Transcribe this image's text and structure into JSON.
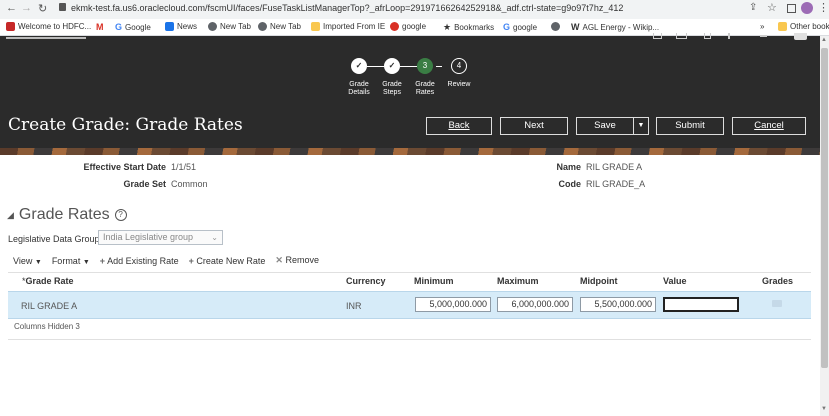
{
  "browser": {
    "url": "ekmk-test.fa.us6.oraclecloud.com/fscmUI/faces/FuseTaskListManagerTop?_afrLoop=29197166264252918&_adf.ctrl-state=g9o97t7hz_412",
    "bookmarks": [
      {
        "label": "Welcome to HDFC...",
        "color": "#c62828"
      },
      {
        "label": "Gmail",
        "color": "#d93025"
      },
      {
        "label": "Google",
        "color": "#4285f4"
      },
      {
        "label": "News",
        "color": "#1a73e8"
      },
      {
        "label": "New Tab",
        "color": "#5f6368"
      },
      {
        "label": "New Tab",
        "color": "#5f6368"
      },
      {
        "label": "Imported From IE",
        "color": "#f9c74f"
      },
      {
        "label": "google",
        "color": "#d93025"
      },
      {
        "label": "Bookmarks",
        "color": "#333333"
      },
      {
        "label": "google",
        "color": "#4285f4"
      },
      {
        "label": "AGL Energy - Wikip...",
        "color": "#333333"
      }
    ],
    "more_label": "»",
    "other_bookmarks": "Other bookmarks"
  },
  "train": {
    "steps": [
      {
        "num": "✓",
        "label1": "Grade",
        "label2": "Details"
      },
      {
        "num": "✓",
        "label1": "Grade",
        "label2": "Steps"
      },
      {
        "num": "3",
        "label1": "Grade",
        "label2": "Rates"
      },
      {
        "num": "4",
        "label1": "Review",
        "label2": ""
      }
    ]
  },
  "page": {
    "title": "Create Grade: Grade Rates",
    "buttons": {
      "back": "Back",
      "next": "Next",
      "save": "Save",
      "submit": "Submit",
      "cancel": "Cancel"
    }
  },
  "summary": {
    "effective_start_date_label": "Effective Start Date",
    "effective_start_date": "1/1/51",
    "grade_set_label": "Grade Set",
    "grade_set": "Common",
    "name_label": "Name",
    "name": "RIL GRADE A",
    "code_label": "Code",
    "code": "RIL GRADE_A"
  },
  "section": {
    "title": "Grade Rates",
    "ldg_label": "Legislative Data Group",
    "ldg_value": "India Legislative group"
  },
  "toolbar": {
    "view": "View",
    "format": "Format",
    "add_existing": "Add Existing Rate",
    "create_new": "Create New Rate",
    "remove": "Remove"
  },
  "table": {
    "headers": {
      "grade_rate": "Grade Rate",
      "currency": "Currency",
      "minimum": "Minimum",
      "maximum": "Maximum",
      "midpoint": "Midpoint",
      "value": "Value",
      "grades": "Grades"
    },
    "row": {
      "grade_rate": "RIL GRADE A",
      "currency": "INR",
      "minimum": "5,000,000.000",
      "maximum": "6,000,000.000",
      "midpoint": "5,500,000.000",
      "value": ""
    },
    "columns_hidden_label": "Columns Hidden",
    "columns_hidden": "3"
  },
  "colors": {
    "accent_green": "#3a7d44",
    "selected_row": "#d6ebf8"
  }
}
